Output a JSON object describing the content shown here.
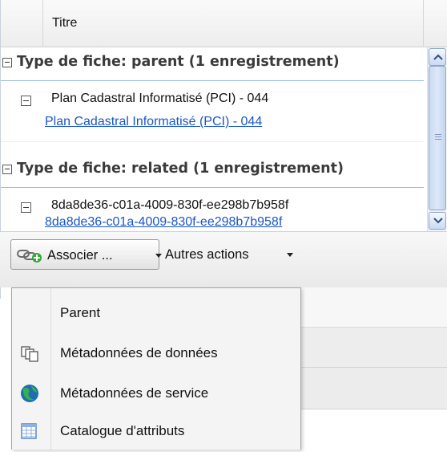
{
  "grid": {
    "column_title": "Titre",
    "groups": [
      {
        "header": "Type de fiche: parent (1 enregistrement)",
        "row": {
          "title": "Plan Cadastral Informatisé (PCI) - 044",
          "link": "Plan Cadastral Informatisé (PCI) - 044"
        }
      },
      {
        "header": "Type de fiche: related (1 enregistrement)",
        "row": {
          "title": "8da8de36-c01a-4009-830f-ee298b7b958f",
          "link": "8da8de36-c01a-4009-830f-ee298b7b958f"
        }
      }
    ]
  },
  "toolbar": {
    "associate_label": "Associer ...",
    "associate_icon": "link-add-icon",
    "other_actions_label": "Autres actions"
  },
  "menu": {
    "items": [
      {
        "label": "Parent",
        "icon": ""
      },
      {
        "label": "Métadonnées de données",
        "icon": "dataset-copies-icon"
      },
      {
        "label": "Métadonnées de service",
        "icon": "service-globe-icon"
      },
      {
        "label": "Catalogue d'attributs",
        "icon": "table-icon"
      }
    ]
  },
  "colors": {
    "link": "#1a56c8",
    "group_border": "#99bbe8",
    "menu_bg": "#f4f4f4"
  }
}
